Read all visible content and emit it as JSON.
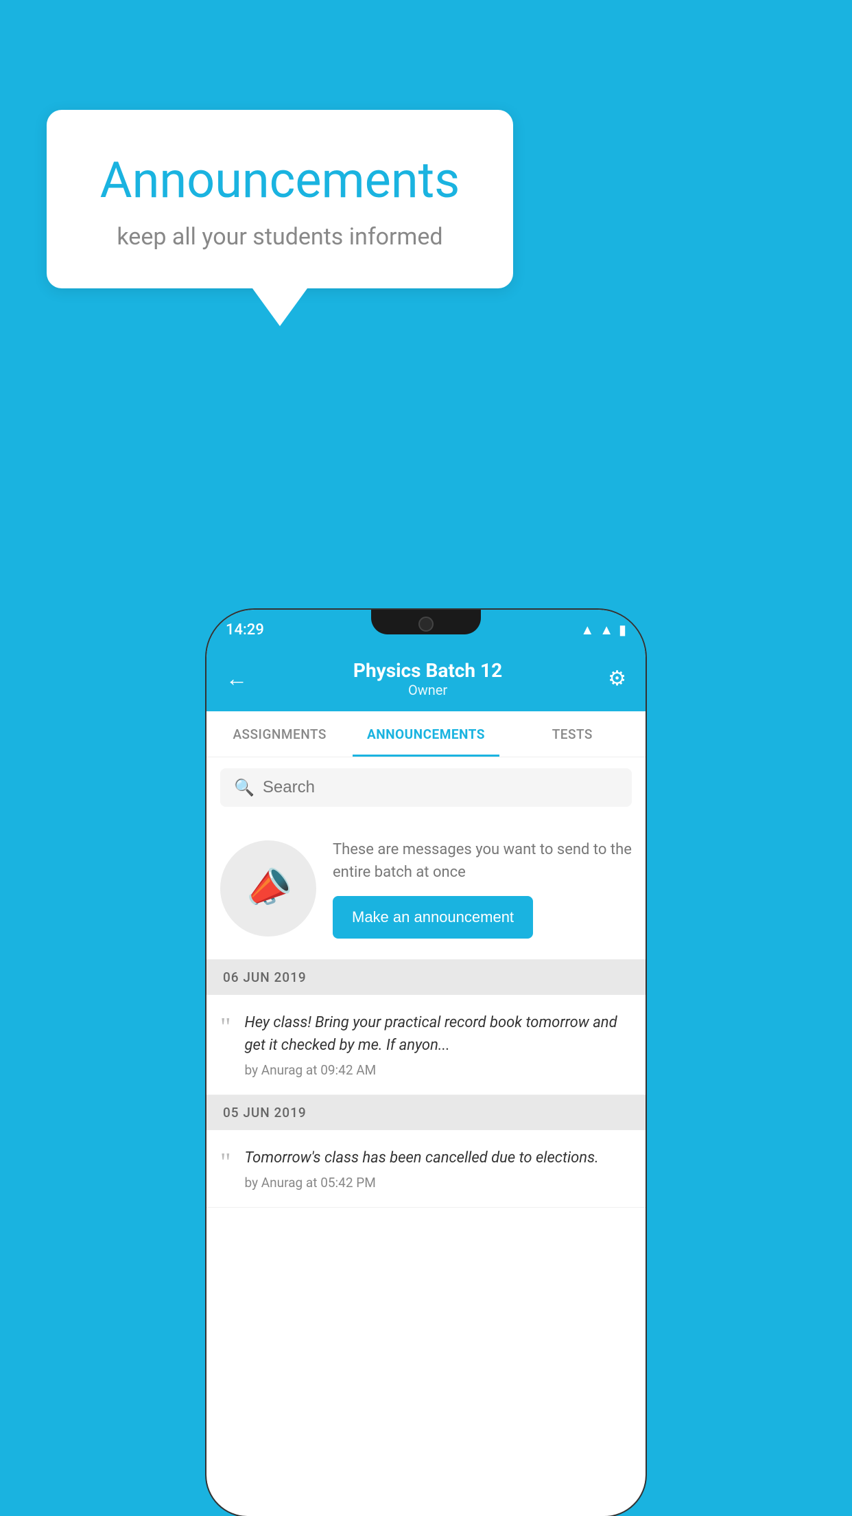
{
  "background_color": "#1ab3e0",
  "speech_bubble": {
    "title": "Announcements",
    "subtitle": "keep all your students informed"
  },
  "phone": {
    "status_bar": {
      "time": "14:29",
      "icons": [
        "wifi",
        "signal",
        "battery"
      ]
    },
    "app_bar": {
      "title": "Physics Batch 12",
      "subtitle": "Owner",
      "back_label": "←",
      "settings_label": "⚙"
    },
    "tabs": [
      {
        "label": "ASSIGNMENTS",
        "active": false
      },
      {
        "label": "ANNOUNCEMENTS",
        "active": true
      },
      {
        "label": "TESTS",
        "active": false
      }
    ],
    "search": {
      "placeholder": "Search"
    },
    "announcement_prompt": {
      "description": "These are messages you want to send to the entire batch at once",
      "button_label": "Make an announcement"
    },
    "announcements": [
      {
        "date": "06  JUN  2019",
        "message": "Hey class! Bring your practical record book tomorrow and get it checked by me. If anyon...",
        "meta": "by Anurag at 09:42 AM"
      },
      {
        "date": "05  JUN  2019",
        "message": "Tomorrow's class has been cancelled due to elections.",
        "meta": "by Anurag at 05:42 PM"
      }
    ]
  }
}
